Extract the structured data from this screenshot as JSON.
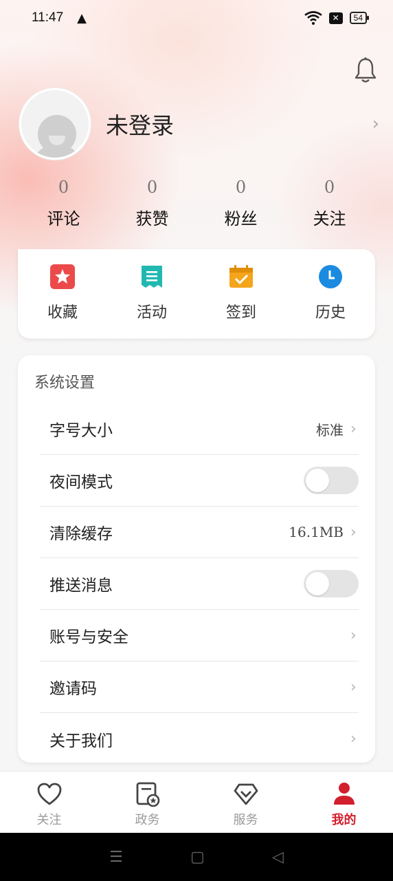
{
  "status_bar": {
    "time": "11:47",
    "battery": "54"
  },
  "profile": {
    "name": "未登录"
  },
  "stats": [
    {
      "num": "0",
      "label": "评论"
    },
    {
      "num": "0",
      "label": "获赞"
    },
    {
      "num": "0",
      "label": "粉丝"
    },
    {
      "num": "0",
      "label": "关注"
    }
  ],
  "quick_actions": [
    {
      "label": "收藏",
      "icon": "star-icon",
      "color": "#ec4a4a"
    },
    {
      "label": "活动",
      "icon": "document-icon",
      "color": "#21b8b0"
    },
    {
      "label": "签到",
      "icon": "calendar-check-icon",
      "color": "#f4a51c"
    },
    {
      "label": "历史",
      "icon": "clock-icon",
      "color": "#1a8be0"
    }
  ],
  "settings": {
    "title": "系统设置",
    "items": [
      {
        "label": "字号大小",
        "value": "标准"
      },
      {
        "label": "夜间模式",
        "toggle": false
      },
      {
        "label": "清除缓存",
        "value": "16.1MB"
      },
      {
        "label": "推送消息",
        "toggle": false
      },
      {
        "label": "账号与安全"
      },
      {
        "label": "邀请码"
      },
      {
        "label": "关于我们"
      }
    ]
  },
  "tabs": [
    {
      "label": "关注",
      "icon": "heart-icon",
      "active": false
    },
    {
      "label": "政务",
      "icon": "gov-affairs-icon",
      "active": false
    },
    {
      "label": "服务",
      "icon": "diamond-icon",
      "active": false
    },
    {
      "label": "我的",
      "icon": "person-icon",
      "active": true
    }
  ],
  "colors": {
    "accent": "#d21f2e"
  }
}
